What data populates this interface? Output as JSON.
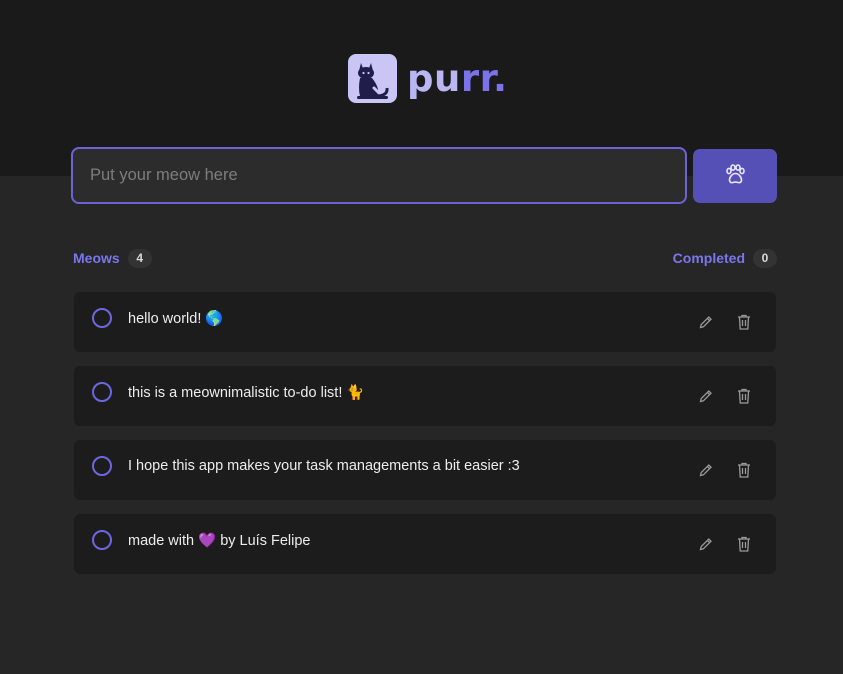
{
  "app": {
    "logo_text_light": "pu",
    "logo_text_accent": "rr.",
    "logo_icon": "cat-check-icon"
  },
  "input": {
    "placeholder": "Put your meow here",
    "value": ""
  },
  "add_button": {
    "icon": "paw-icon"
  },
  "counters": {
    "meows_label": "Meows",
    "meows_count": "4",
    "completed_label": "Completed",
    "completed_count": "0"
  },
  "tasks": [
    {
      "text": "hello world! 🌎",
      "completed": false
    },
    {
      "text": "this is a meownimalistic to-do list! 🐈",
      "completed": false
    },
    {
      "text": "I hope this app makes your task managements a bit easier :3",
      "completed": false
    },
    {
      "text": "made with 💜 by Luís Felipe",
      "completed": false
    }
  ],
  "colors": {
    "accent": "#7c76ec",
    "button": "#5550b5",
    "header_bg": "#1a1a1a",
    "page_bg": "#262626",
    "card_bg": "#1c1c1c"
  }
}
